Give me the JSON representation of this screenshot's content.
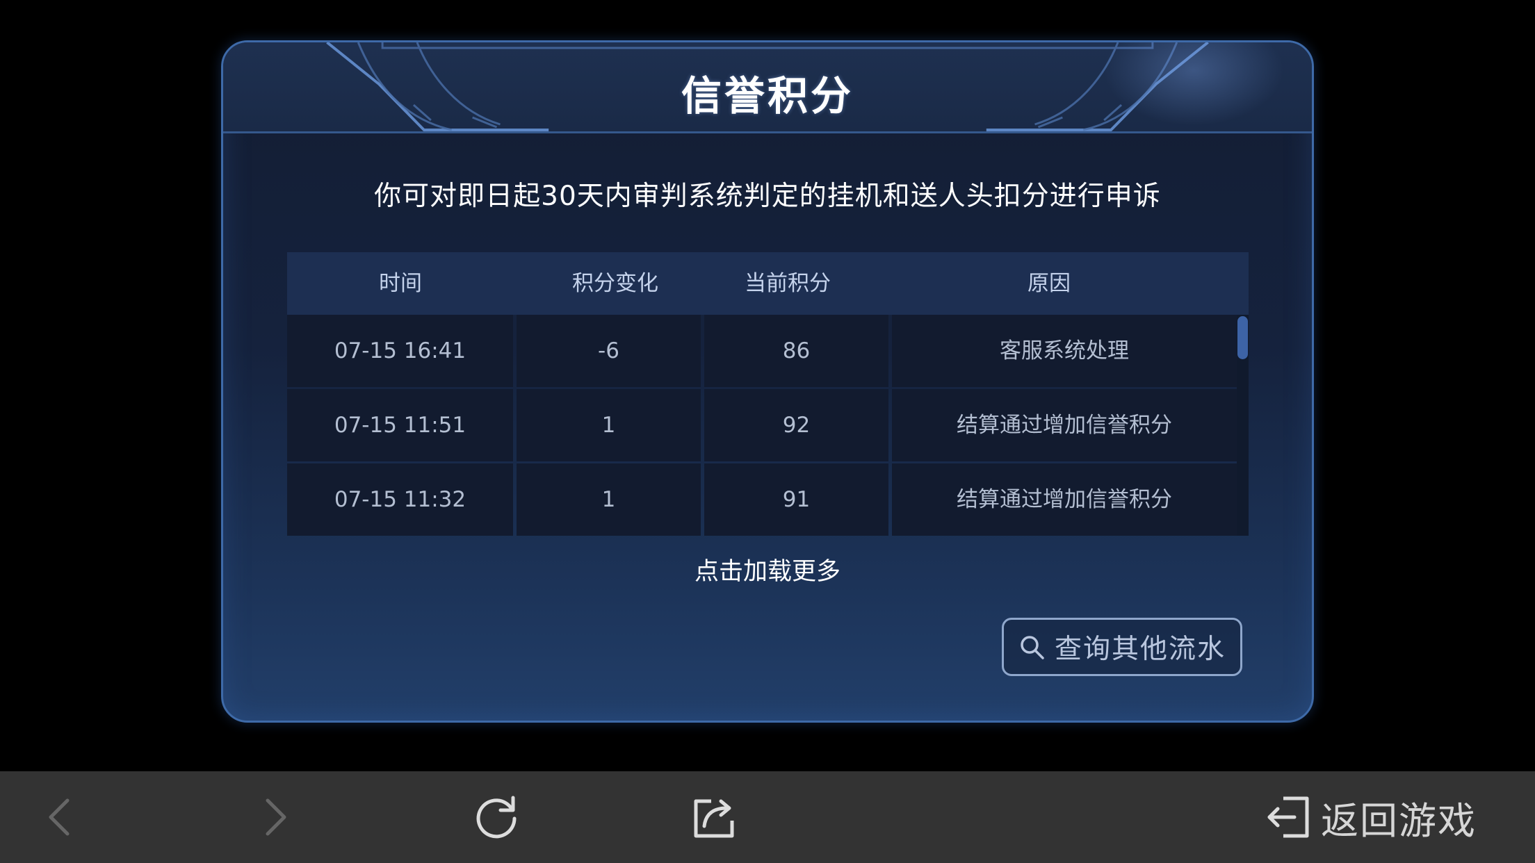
{
  "dialog": {
    "title": "信誉积分",
    "notice": "你可对即日起30天内审判系统判定的挂机和送人头扣分进行申诉",
    "table": {
      "headers": [
        "时间",
        "积分变化",
        "当前积分",
        "原因"
      ],
      "rows": [
        {
          "time": "07-15  16:41",
          "change": "-6",
          "score": "86",
          "reason": "客服系统处理"
        },
        {
          "time": "07-15  11:51",
          "change": "1",
          "score": "92",
          "reason": "结算通过增加信誉积分"
        },
        {
          "time": "07-15  11:32",
          "change": "1",
          "score": "91",
          "reason": "结算通过增加信誉积分"
        }
      ]
    },
    "load_more": "点击加载更多",
    "query_button": "查询其他流水"
  },
  "bottom_bar": {
    "return_label": "返回游戏"
  },
  "colors": {
    "panel_border": "#3e6aa8",
    "panel_bg": "#15223d",
    "table_header_bg": "#1d2f52",
    "table_cell_bg": "#121b2f",
    "scrollbar_thumb": "#3d63a6",
    "bottom_bar_bg": "#333333"
  },
  "icons": {
    "query": "search-icon",
    "back": "chevron-left-icon",
    "forward": "chevron-right-icon",
    "refresh": "refresh-icon",
    "share": "share-icon",
    "return": "exit-icon"
  }
}
